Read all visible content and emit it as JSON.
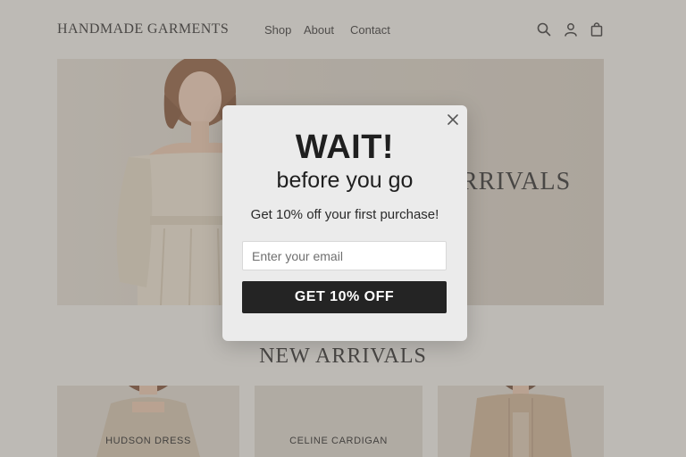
{
  "header": {
    "logo": "HANDMADE GARMENTS",
    "nav": [
      {
        "label": "Shop"
      },
      {
        "label": "About"
      },
      {
        "label": "Contact"
      }
    ],
    "icons": [
      "search-icon",
      "account-icon",
      "bag-icon"
    ]
  },
  "hero": {
    "title": "RRIVALS"
  },
  "section": {
    "title": "NEW ARRIVALS",
    "products": [
      {
        "name": "HUDSON DRESS"
      },
      {
        "name": "CELINE CARDIGAN"
      },
      {
        "name": ""
      }
    ]
  },
  "popup": {
    "heading": "WAIT!",
    "subheading": "before you go",
    "offer": "Get 10% off your first purchase!",
    "email_placeholder": "Enter your email",
    "email_value": "",
    "button_label": "GET 10% OFF",
    "close_icon": "close-icon"
  },
  "colors": {
    "page_background": "#ece9e4",
    "hero_background": "#d4cdc2",
    "modal_background": "#ebebeb",
    "button_background": "#242424",
    "button_text": "#ffffff"
  }
}
